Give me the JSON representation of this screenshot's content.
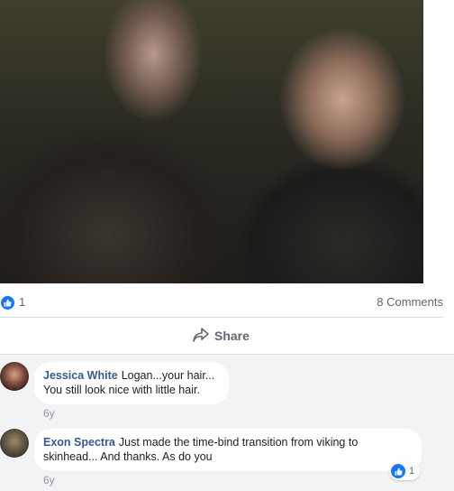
{
  "post": {
    "reaction_count": "1",
    "comments_count": "8 Comments",
    "share_label": "Share"
  },
  "comments": [
    {
      "author": "Jessica White",
      "text": "Logan...your hair... You still look nice with little hair.",
      "time": "6y"
    },
    {
      "author": "Exon Spectra",
      "text": "Just made the time-bind transition from viking to skinhead... And thanks. As do you",
      "time": "6y",
      "reaction_count": "1"
    }
  ],
  "colors": {
    "link_blue": "#385898",
    "like_blue": "#1877f2",
    "muted_text": "#606770"
  }
}
